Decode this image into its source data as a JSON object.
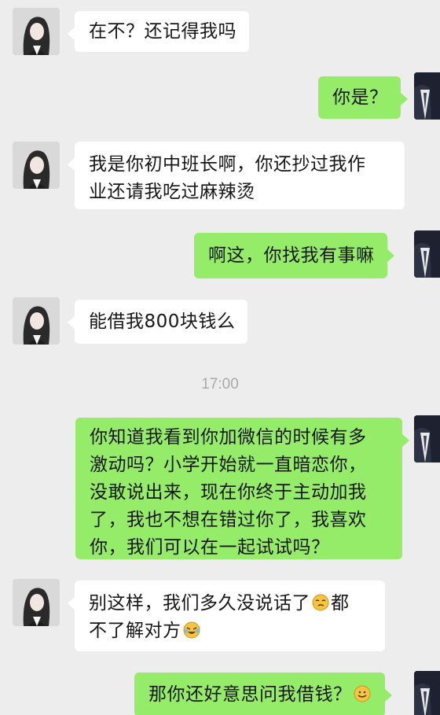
{
  "messages": [
    {
      "side": "in",
      "text": "在不？还记得我吗"
    },
    {
      "side": "out",
      "text": "你是？"
    },
    {
      "side": "in",
      "lines": [
        "我是你初中班长啊，你还抄过我作",
        "业还请我吃过麻辣烫"
      ]
    },
    {
      "side": "out",
      "text": "啊这，你找我有事嘛"
    },
    {
      "side": "in",
      "text": "能借我800块钱么"
    },
    {
      "side": "out",
      "lines": [
        "你知道我看到你加微信的时候有多",
        "激动吗？小学开始就一直暗恋你，",
        "没敢说出来，现在你终于主动加我",
        "了，我也不想在错过你了，我喜欢",
        "你，我们可以在一起试试吗？"
      ]
    },
    {
      "side": "in",
      "line1_a": "别这样，我们多久没说话了",
      "line1_b": "都",
      "line2": "不了解对方",
      "emoji1": "emoji-smirk-icon",
      "emoji2": "emoji-laughing-crying-icon"
    },
    {
      "side": "out",
      "text": "那你还好意思问我借钱？",
      "emoji": "emoji-smile-icon"
    }
  ],
  "timestamp": "17:00",
  "colors": {
    "background": "#ededed",
    "outgoing": "#95ec69",
    "incoming": "#ffffff"
  }
}
